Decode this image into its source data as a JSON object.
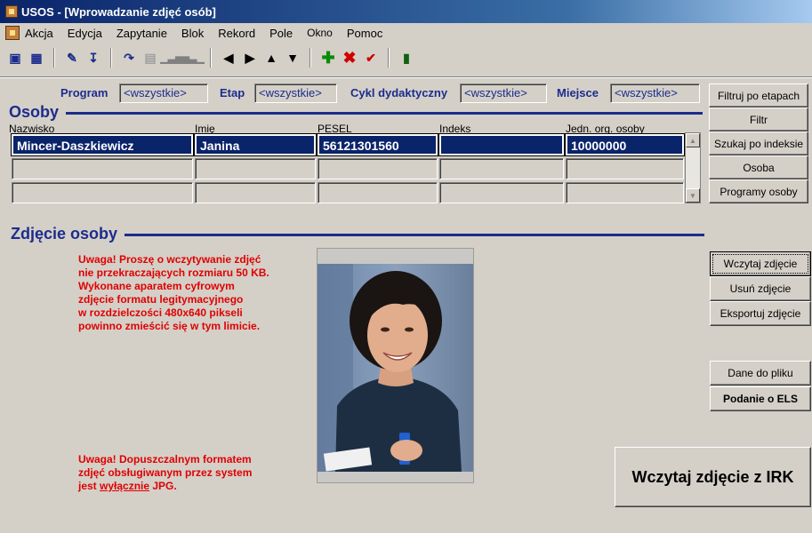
{
  "window": {
    "title": "USOS - [Wprowadzanie zdjęć osób]"
  },
  "menu": [
    "Akcja",
    "Edycja",
    "Zapytanie",
    "Blok",
    "Rekord",
    "Pole",
    "Okno",
    "Pomoc"
  ],
  "filters": {
    "program_label": "Program",
    "program_value": "<wszystkie>",
    "etap_label": "Etap",
    "etap_value": "<wszystkie>",
    "cykl_label": "Cykl dydaktyczny",
    "cykl_value": "<wszystkie>",
    "miejsce_label": "Miejsce",
    "miejsce_value": "<wszystkie>"
  },
  "osoby": {
    "title": "Osoby",
    "columns": [
      "Nazwisko",
      "Imię",
      "PESEL",
      "Indeks",
      "Jedn. org. osoby"
    ],
    "rows": [
      [
        "Mincer-Daszkiewicz",
        "Janina",
        "56121301560",
        "",
        "10000000"
      ],
      [
        "",
        "",
        "",
        "",
        ""
      ],
      [
        "",
        "",
        "",
        "",
        ""
      ]
    ]
  },
  "side_buttons": {
    "filtruj": "Filtruj po etapach",
    "filtr": "Filtr",
    "szukaj": "Szukaj po indeksie",
    "osoba": "Osoba",
    "programy": "Programy osoby"
  },
  "photo_section": {
    "title": "Zdjęcie osoby",
    "warning1": [
      "Uwaga! Proszę o wczytywanie zdjęć",
      "nie przekraczających rozmiaru 50 KB.",
      "Wykonane aparatem cyfrowym",
      "zdjęcie formatu legitymacyjnego",
      "w rozdzielczości 480x640 pikseli",
      "powinno zmieścić się w tym limicie."
    ],
    "warning2_line1": "Uwaga! Dopuszczalnym formatem",
    "warning2_line2": "zdjęć obsługiwanym przez system",
    "warning2_prefix": "jest ",
    "warning2_underlined": "wyłącznie",
    "warning2_suffix": " JPG."
  },
  "photo_buttons": {
    "wczytaj": "Wczytaj zdjęcie",
    "usun": "Usuń zdjęcie",
    "eksportuj": "Eksportuj zdjęcie",
    "dane": "Dane do pliku",
    "podanie": "Podanie o ELS",
    "irk": "Wczytaj zdjęcie z IRK"
  },
  "colors": {
    "accent": "#1c2c8c",
    "selection": "#0a246a",
    "warning": "#e00000",
    "face": "#d4d0c8"
  }
}
